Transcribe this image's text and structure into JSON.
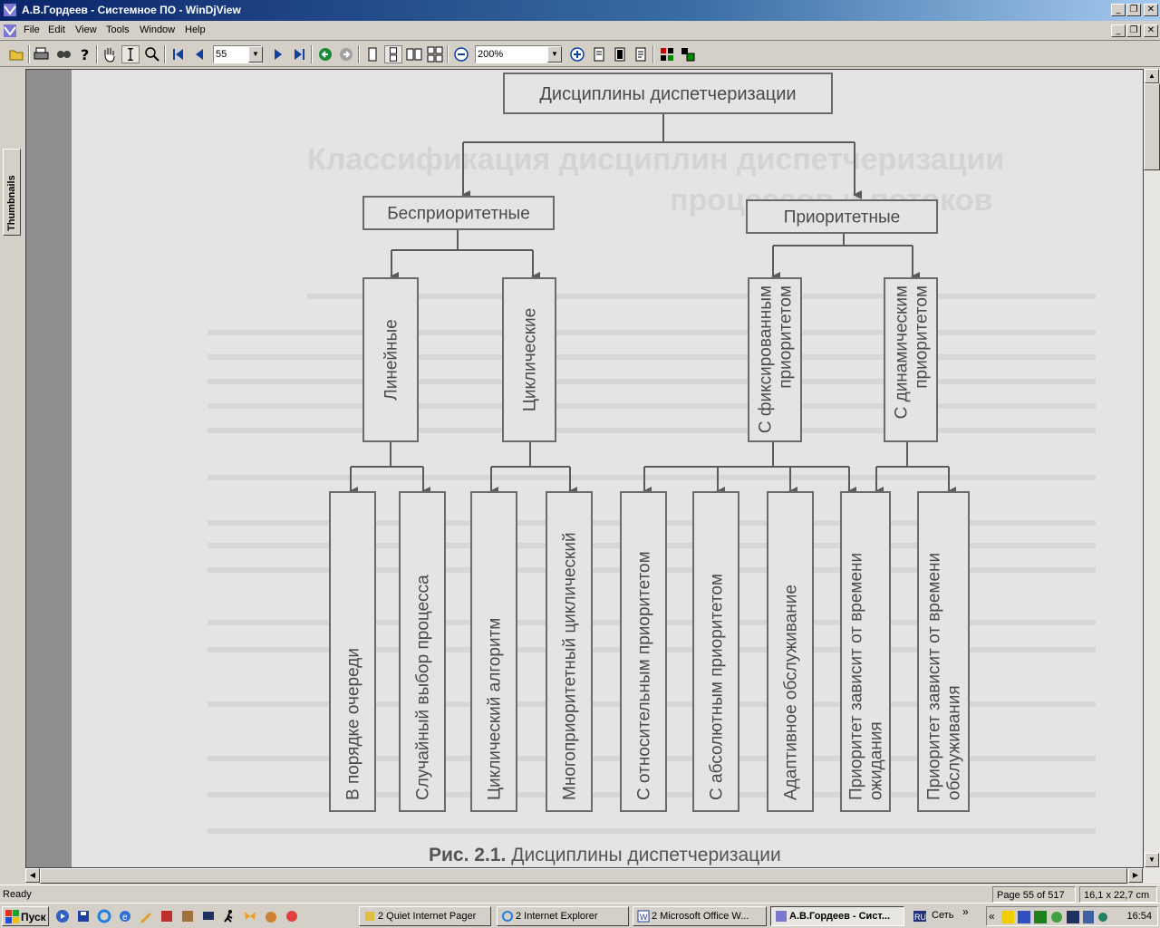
{
  "window": {
    "title": "А.В.Гордеев - Системное ПО - WinDjView",
    "min_glyph": "_",
    "max_glyph": "❐",
    "close_glyph": "✕"
  },
  "menu": [
    "File",
    "Edit",
    "View",
    "Tools",
    "Window",
    "Help"
  ],
  "toolbar": {
    "page_value": "55",
    "zoom_value": "200%"
  },
  "sidebar": {
    "tab_label": "Thumbnails"
  },
  "document": {
    "root": "Дисциплины диспетчеризации",
    "background_heading_1": "Классификация дисциплин диспетчеризации",
    "background_heading_2": "процессов и потоков",
    "level1": [
      "Бесприоритетные",
      "Приоритетные"
    ],
    "level2": [
      "Линейные",
      "Циклические",
      "С фиксированным|приоритетом",
      "С динамическим|приоритетом"
    ],
    "level3": [
      "В порядке очереди",
      "Случайный выбор процесса",
      "Циклический алгоритм",
      "Многоприоритетный циклический",
      "С относительным приоритетом",
      "С абсолютным приоритетом",
      "Адаптивное обслуживание",
      "Приоритет зависит от времени|ожидания",
      "Приоритет зависит от времени|обслуживания"
    ],
    "caption_bold": "Рис. 2.1.",
    "caption_text": "Дисциплины диспетчеризации"
  },
  "statusbar": {
    "status": "Ready",
    "page_info": "Page 55 of 517",
    "size_info": "16,1 x 22,7 cm"
  },
  "taskbar": {
    "start_label": "Пуск",
    "tasks": [
      "2 Quiet Internet Pager",
      "2 Internet Explorer",
      "2 Microsoft Office W...",
      "А.В.Гордеев - Сист..."
    ],
    "network_label": "Сеть",
    "clock": "16:54"
  },
  "colors": {
    "title_active": "#0a246a",
    "page_bg": "#e4e4e4",
    "ink": "#4a4a4a"
  }
}
